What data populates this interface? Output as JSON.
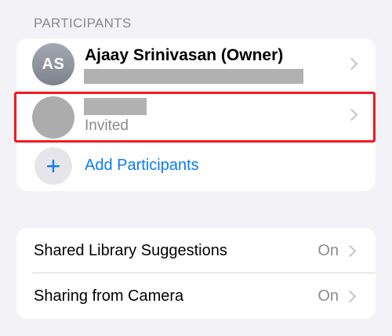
{
  "section": {
    "header": "PARTICIPANTS"
  },
  "participants": {
    "owner": {
      "initials": "AS",
      "name": "Ajaay Srinivasan (Owner)"
    },
    "invited": {
      "status": "Invited"
    },
    "add_label": "Add Participants"
  },
  "settings": [
    {
      "label": "Shared Library Suggestions",
      "value": "On"
    },
    {
      "label": "Sharing from Camera",
      "value": "On"
    }
  ],
  "colors": {
    "accent": "#0a7cf5",
    "highlight": "#ee1b24",
    "background": "#f2f2f7"
  },
  "icons": {
    "add": "plus-icon",
    "disclosure": "chevron-right-icon"
  }
}
